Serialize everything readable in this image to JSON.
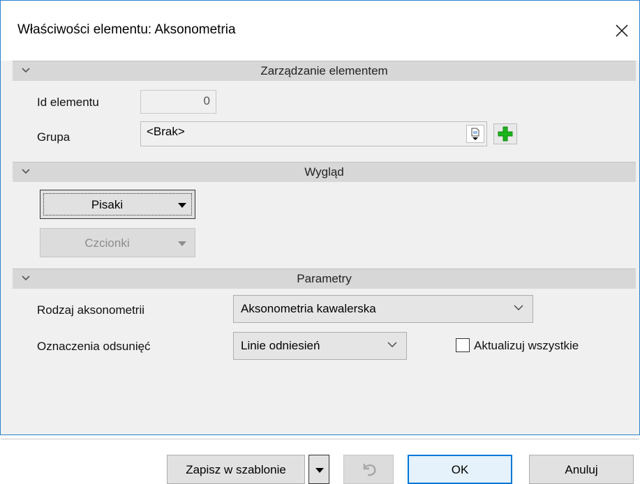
{
  "window": {
    "title": "Właściwości elementu: Aksonometria",
    "close_glyph": "✕"
  },
  "sections": {
    "management": {
      "label": "Zarządzanie elementem"
    },
    "appearance": {
      "label": "Wygląd"
    },
    "parameters": {
      "label": "Parametry"
    }
  },
  "management": {
    "id_label": "Id elementu",
    "id_value": "0",
    "group_label": "Grupa",
    "group_value": "<Brak>"
  },
  "appearance": {
    "pens_label": "Pisaki",
    "fonts_label": "Czcionki"
  },
  "parameters": {
    "axonometry_type_label": "Rodzaj aksonometrii",
    "axonometry_type_value": "Aksonometria kawalerska",
    "offset_marks_label": "Oznaczenia odsunięć",
    "offset_marks_value": "Linie odniesień",
    "update_all_label": "Aktualizuj wszystkie",
    "update_all_checked": false
  },
  "footer": {
    "save_template_label": "Zapisz w szablonie",
    "ok_label": "OK",
    "cancel_label": "Anuluj"
  },
  "colors": {
    "accent_border": "#2b7fd0",
    "add_icon_green": "#1bb31b",
    "header_band": "#d7d7d7"
  }
}
